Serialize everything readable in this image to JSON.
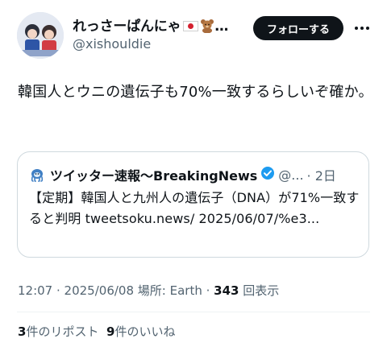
{
  "author": {
    "display_name": "れっさーぱんにゃ",
    "name_ellipsis": "…",
    "handle": "@xishouldie",
    "flag_icon": "japan-flag-icon",
    "emoji_icon": "teddy-bear-icon"
  },
  "follow_button": {
    "label": "フォローする"
  },
  "tweet": {
    "text": "韓国人とウニの遺伝子も70%一致するらしいぞ確か。"
  },
  "quote": {
    "author_name": "ツイッター速報〜BreakingNews",
    "handle_truncated": "@...",
    "time": "· 2日",
    "text": "【定期】韓国人と九州人の遺伝子（DNA）が71%一致すると判明 tweetsoku.news/ 2025/06/07/%e3..."
  },
  "meta": {
    "time": "12:07",
    "date": "2025/06/08",
    "location_label": "場所: Earth",
    "views_count": "343",
    "views_label": "回表示",
    "separator": " · "
  },
  "stats": {
    "reposts_count": "3",
    "reposts_label": "件のリポスト",
    "likes_count": "9",
    "likes_label": "件のいいね"
  },
  "colors": {
    "text_primary": "#0f1419",
    "text_secondary": "#536471",
    "border": "#cfd9de",
    "verified": "#1d9bf0",
    "follow_bg": "#0f1419"
  }
}
